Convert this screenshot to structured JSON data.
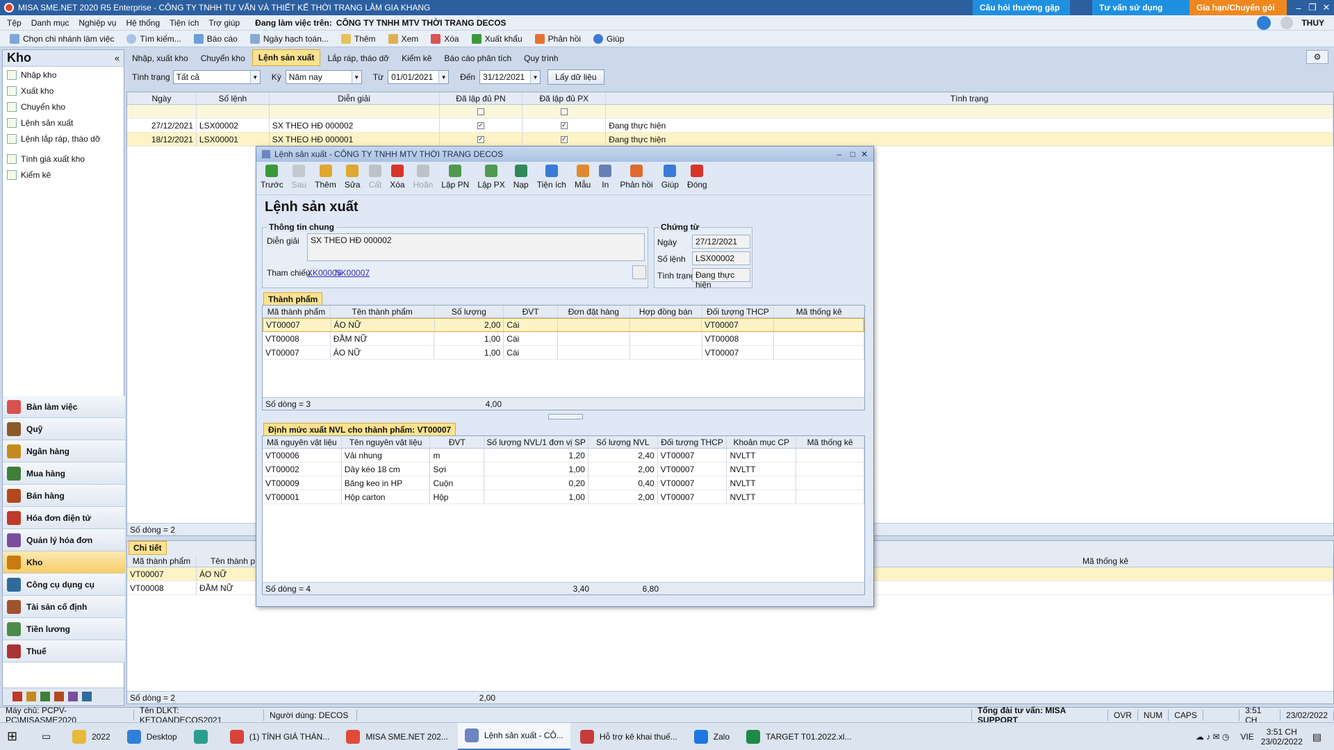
{
  "window": {
    "title": "MISA SME.NET 2020 R5 Enterprise - CÔNG TY TNHH TƯ VẤN VÀ THIẾT KẾ THỜI TRANG LÂM GIA KHANG",
    "faq": "Câu hỏi thường gặp",
    "guide": "Tư vấn sử dụng",
    "renew": "Gia hạn/Chuyển gói",
    "user": "THUY"
  },
  "menu": {
    "items": [
      "Tệp",
      "Danh mục",
      "Nghiệp vụ",
      "Hệ thống",
      "Tiện ích",
      "Trợ giúp"
    ],
    "working_label": "Đang làm việc trên:",
    "working_company": "CÔNG TY TNHH MTV THỜI TRANG DECOS"
  },
  "toolbar": {
    "items": [
      "Chọn chi nhánh làm việc",
      "Tìm kiếm...",
      "Báo cáo",
      "Ngày hạch toán...",
      "Thêm",
      "Xem",
      "Xóa",
      "Xuất khẩu",
      "Phản hồi",
      "Giúp"
    ]
  },
  "sidebar": {
    "title": "Kho",
    "collapse": "«",
    "items": [
      "Nhập kho",
      "Xuất kho",
      "Chuyển kho",
      "Lệnh sản xuất",
      "Lệnh lắp ráp, tháo dỡ",
      "Tính giá xuất kho",
      "Kiểm kê"
    ],
    "modules": [
      "Bàn làm việc",
      "Quỹ",
      "Ngân hàng",
      "Mua hàng",
      "Bán hàng",
      "Hóa đơn điện tử",
      "Quản lý hóa đơn",
      "Kho",
      "Công cụ dụng cụ",
      "Tài sản cố định",
      "Tiền lương",
      "Thuế"
    ],
    "module_colors": [
      "#d9534f",
      "#8a5a2b",
      "#c48a1e",
      "#3f7f3a",
      "#b3491d",
      "#c0392b",
      "#7a4e9c",
      "#c97b12",
      "#2f6b9a",
      "#a0522d",
      "#4c8c4a",
      "#a33"
    ]
  },
  "tabs": [
    "Nhập, xuất kho",
    "Chuyển kho",
    "Lệnh sản xuất",
    "Lắp ráp, tháo dỡ",
    "Kiểm kê",
    "Báo cáo phân tích",
    "Quy trình"
  ],
  "filter": {
    "status_label": "Tình trạng",
    "status_value": "Tất cả",
    "period_label": "Kỳ",
    "period_value": "Năm nay",
    "from_label": "Từ",
    "from_value": "01/01/2021",
    "to_label": "Đến",
    "to_value": "31/12/2021",
    "fetch_button": "Lấy dữ liệu"
  },
  "main_grid": {
    "headers": [
      "Ngày",
      "Số lệnh",
      "Diễn giải",
      "Đã lập đủ PN",
      "Đã lập đủ PX",
      "Tình trạng"
    ],
    "rows": [
      {
        "date": "27/12/2021",
        "no": "LSX00002",
        "desc": "SX THEO HĐ 000002",
        "pn": "✓",
        "px": "✓",
        "status": "Đang thực hiện"
      },
      {
        "date": "18/12/2021",
        "no": "LSX00001",
        "desc": "SX THEO HĐ 000001",
        "pn": "✓",
        "px": "✓",
        "status": "Đang thực hiện"
      }
    ],
    "footer": "Số dòng = 2"
  },
  "detail": {
    "label": "Chi tiết",
    "headers": [
      "Mã thành phẩm",
      "Tên thành p",
      "Mã thống kê"
    ],
    "rows": [
      {
        "code": "VT00007",
        "name": "ÁO NỮ"
      },
      {
        "code": "VT00008",
        "name": "ĐẦM NỮ"
      }
    ],
    "footer": "Số dòng = 2",
    "footer_total": "2,00"
  },
  "dialog": {
    "title": "Lệnh sản xuất - CÔNG TY TNHH MTV THỜI TRANG DECOS",
    "heading": "Lệnh sản xuất",
    "tools": [
      {
        "label": "Trước",
        "color": "#3a9a3a",
        "disabled": false
      },
      {
        "label": "Sau",
        "color": "#9a9a9a",
        "disabled": true
      },
      {
        "label": "Thêm",
        "color": "#e0a82e",
        "disabled": false
      },
      {
        "label": "Sửa",
        "color": "#e0a82e",
        "disabled": false
      },
      {
        "label": "Cất",
        "color": "#8a8a8a",
        "disabled": true
      },
      {
        "label": "Xóa",
        "color": "#d9342b",
        "disabled": false
      },
      {
        "label": "Hoãn",
        "color": "#8a8a8a",
        "disabled": true
      },
      {
        "label": "Lập PN",
        "color": "#4f9a4f",
        "disabled": false
      },
      {
        "label": "Lập PX",
        "color": "#4f9a4f",
        "disabled": false
      },
      {
        "label": "Nạp",
        "color": "#2e8b57",
        "disabled": false
      },
      {
        "label": "Tiện ích",
        "color": "#3a7bd5",
        "disabled": false
      },
      {
        "label": "Mẫu",
        "color": "#e08a2e",
        "disabled": false
      },
      {
        "label": "In",
        "color": "#6a7fb5",
        "disabled": false
      },
      {
        "label": "Phản hồi",
        "color": "#e06a2e",
        "disabled": false
      },
      {
        "label": "Giúp",
        "color": "#3a7bd5",
        "disabled": false
      },
      {
        "label": "Đóng",
        "color": "#d9342b",
        "disabled": false
      }
    ],
    "general": {
      "legend": "Thông tin chung",
      "desc_label": "Diễn giải",
      "desc_value": "SX THEO HĐ 000002",
      "ref_label": "Tham chiếu",
      "ref1": "XK00005",
      "ref2": "NK00007",
      "ref_more": "..."
    },
    "voucher": {
      "legend": "Chứng từ",
      "date_label": "Ngày",
      "date_value": "27/12/2021",
      "no_label": "Số lệnh",
      "no_value": "LSX00002",
      "status_label": "Tình trạng",
      "status_value": "Đang thực hiện"
    },
    "products": {
      "label": "Thành phẩm",
      "headers": [
        "Mã thành phẩm",
        "Tên thành phẩm",
        "Số lượng",
        "ĐVT",
        "Đơn đặt hàng",
        "Hợp đồng bán",
        "Đối tượng THCP",
        "Mã thống kê"
      ],
      "rows": [
        {
          "code": "VT00007",
          "name": "ÁO NỮ",
          "qty": "2,00",
          "unit": "Cái",
          "thcp": "VT00007"
        },
        {
          "code": "VT00008",
          "name": "ĐẦM NỮ",
          "qty": "1,00",
          "unit": "Cái",
          "thcp": "VT00008"
        },
        {
          "code": "VT00007",
          "name": "ÁO NỮ",
          "qty": "1,00",
          "unit": "Cái",
          "thcp": "VT00007"
        }
      ],
      "footer": "Số dòng = 3",
      "footer_total": "4,00"
    },
    "materials": {
      "label": "Định mức xuất NVL cho thành phẩm: VT00007",
      "headers": [
        "Mã nguyên vật liệu",
        "Tên nguyên vật liệu",
        "ĐVT",
        "Số lượng NVL/1 đơn vị SP",
        "Số lượng NVL",
        "Đối tượng THCP",
        "Khoản mục CP",
        "Mã thống kê"
      ],
      "rows": [
        {
          "code": "VT00006",
          "name": "Vải nhung",
          "unit": "m",
          "per": "1,20",
          "qty": "2,40",
          "thcp": "VT00007",
          "cp": "NVLTT"
        },
        {
          "code": "VT00002",
          "name": "Dây kéo 18 cm",
          "unit": "Sợi",
          "per": "1,00",
          "qty": "2,00",
          "thcp": "VT00007",
          "cp": "NVLTT"
        },
        {
          "code": "VT00009",
          "name": "Băng keo in HP",
          "unit": "Cuộn",
          "per": "0,20",
          "qty": "0,40",
          "thcp": "VT00007",
          "cp": "NVLTT"
        },
        {
          "code": "VT00001",
          "name": "Hộp carton",
          "unit": "Hộp",
          "per": "1,00",
          "qty": "2,00",
          "thcp": "VT00007",
          "cp": "NVLTT"
        }
      ],
      "footer": "Số dòng = 4",
      "footer_per": "3,40",
      "footer_qty": "6,80"
    }
  },
  "statusbar": {
    "server": "Máy chủ: PCPV-PC\\MISASME2020",
    "db": "Tên DLKT: KETOANDECOS2021",
    "user": "Người dùng: DECOS",
    "support": "Tổng đài tư vấn: MISA SUPPORT",
    "ovr": "OVR",
    "num": "NUM",
    "caps": "CAPS",
    "time": "3:51 CH",
    "date": "23/02/2022"
  },
  "taskbar": {
    "tasks": [
      {
        "label": "2022",
        "color": "#e8b93a"
      },
      {
        "label": "Desktop",
        "color": "#2f7fd8"
      },
      {
        "label": "",
        "color": "#2a9d8f"
      },
      {
        "label": "(1) TÍNH GIÁ THÀN...",
        "color": "#d9433a"
      },
      {
        "label": "MISA SME.NET 202...",
        "color": "#e14a3a"
      },
      {
        "label": "Lệnh sản xuất - CÔ...",
        "color": "#6b86c2"
      },
      {
        "label": "Hỗ trợ kê khai thuế...",
        "color": "#c73b3b"
      },
      {
        "label": "Zalo",
        "color": "#1f76e0"
      },
      {
        "label": "TARGET T01.2022.xl...",
        "color": "#1f8a48"
      }
    ],
    "lang": "VIE",
    "time": "3:51 CH",
    "date": "23/02/2022"
  }
}
